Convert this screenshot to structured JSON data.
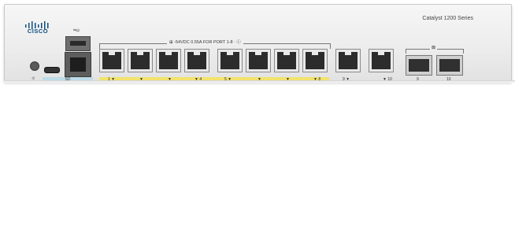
{
  "brand": {
    "name": "CISCO"
  },
  "model": {
    "series": "Catalyst 1200 Series"
  },
  "labels": {
    "reset": "⚙",
    "usb": "⇆ψ",
    "sd": "SD",
    "poe": "⊞ -54VDC 0.55A FOR PORT 1-8 · ⓒ",
    "sfp_icon": "⊠"
  },
  "copper_ports": [
    {
      "id": "1",
      "label": "1 ▼"
    },
    {
      "id": "2",
      "label": "▼"
    },
    {
      "id": "3",
      "label": "▼"
    },
    {
      "id": "4",
      "label": "▼ 4"
    },
    {
      "id": "5",
      "label": "5 ▼"
    },
    {
      "id": "6",
      "label": "▼"
    },
    {
      "id": "7",
      "label": "▼"
    },
    {
      "id": "8",
      "label": "▼ 8"
    },
    {
      "id": "9",
      "label": "9 ▼"
    },
    {
      "id": "10",
      "label": "▼ 10"
    }
  ],
  "sfp_ports": [
    {
      "id": "9",
      "label": "9"
    },
    {
      "id": "10",
      "label": "10"
    }
  ]
}
